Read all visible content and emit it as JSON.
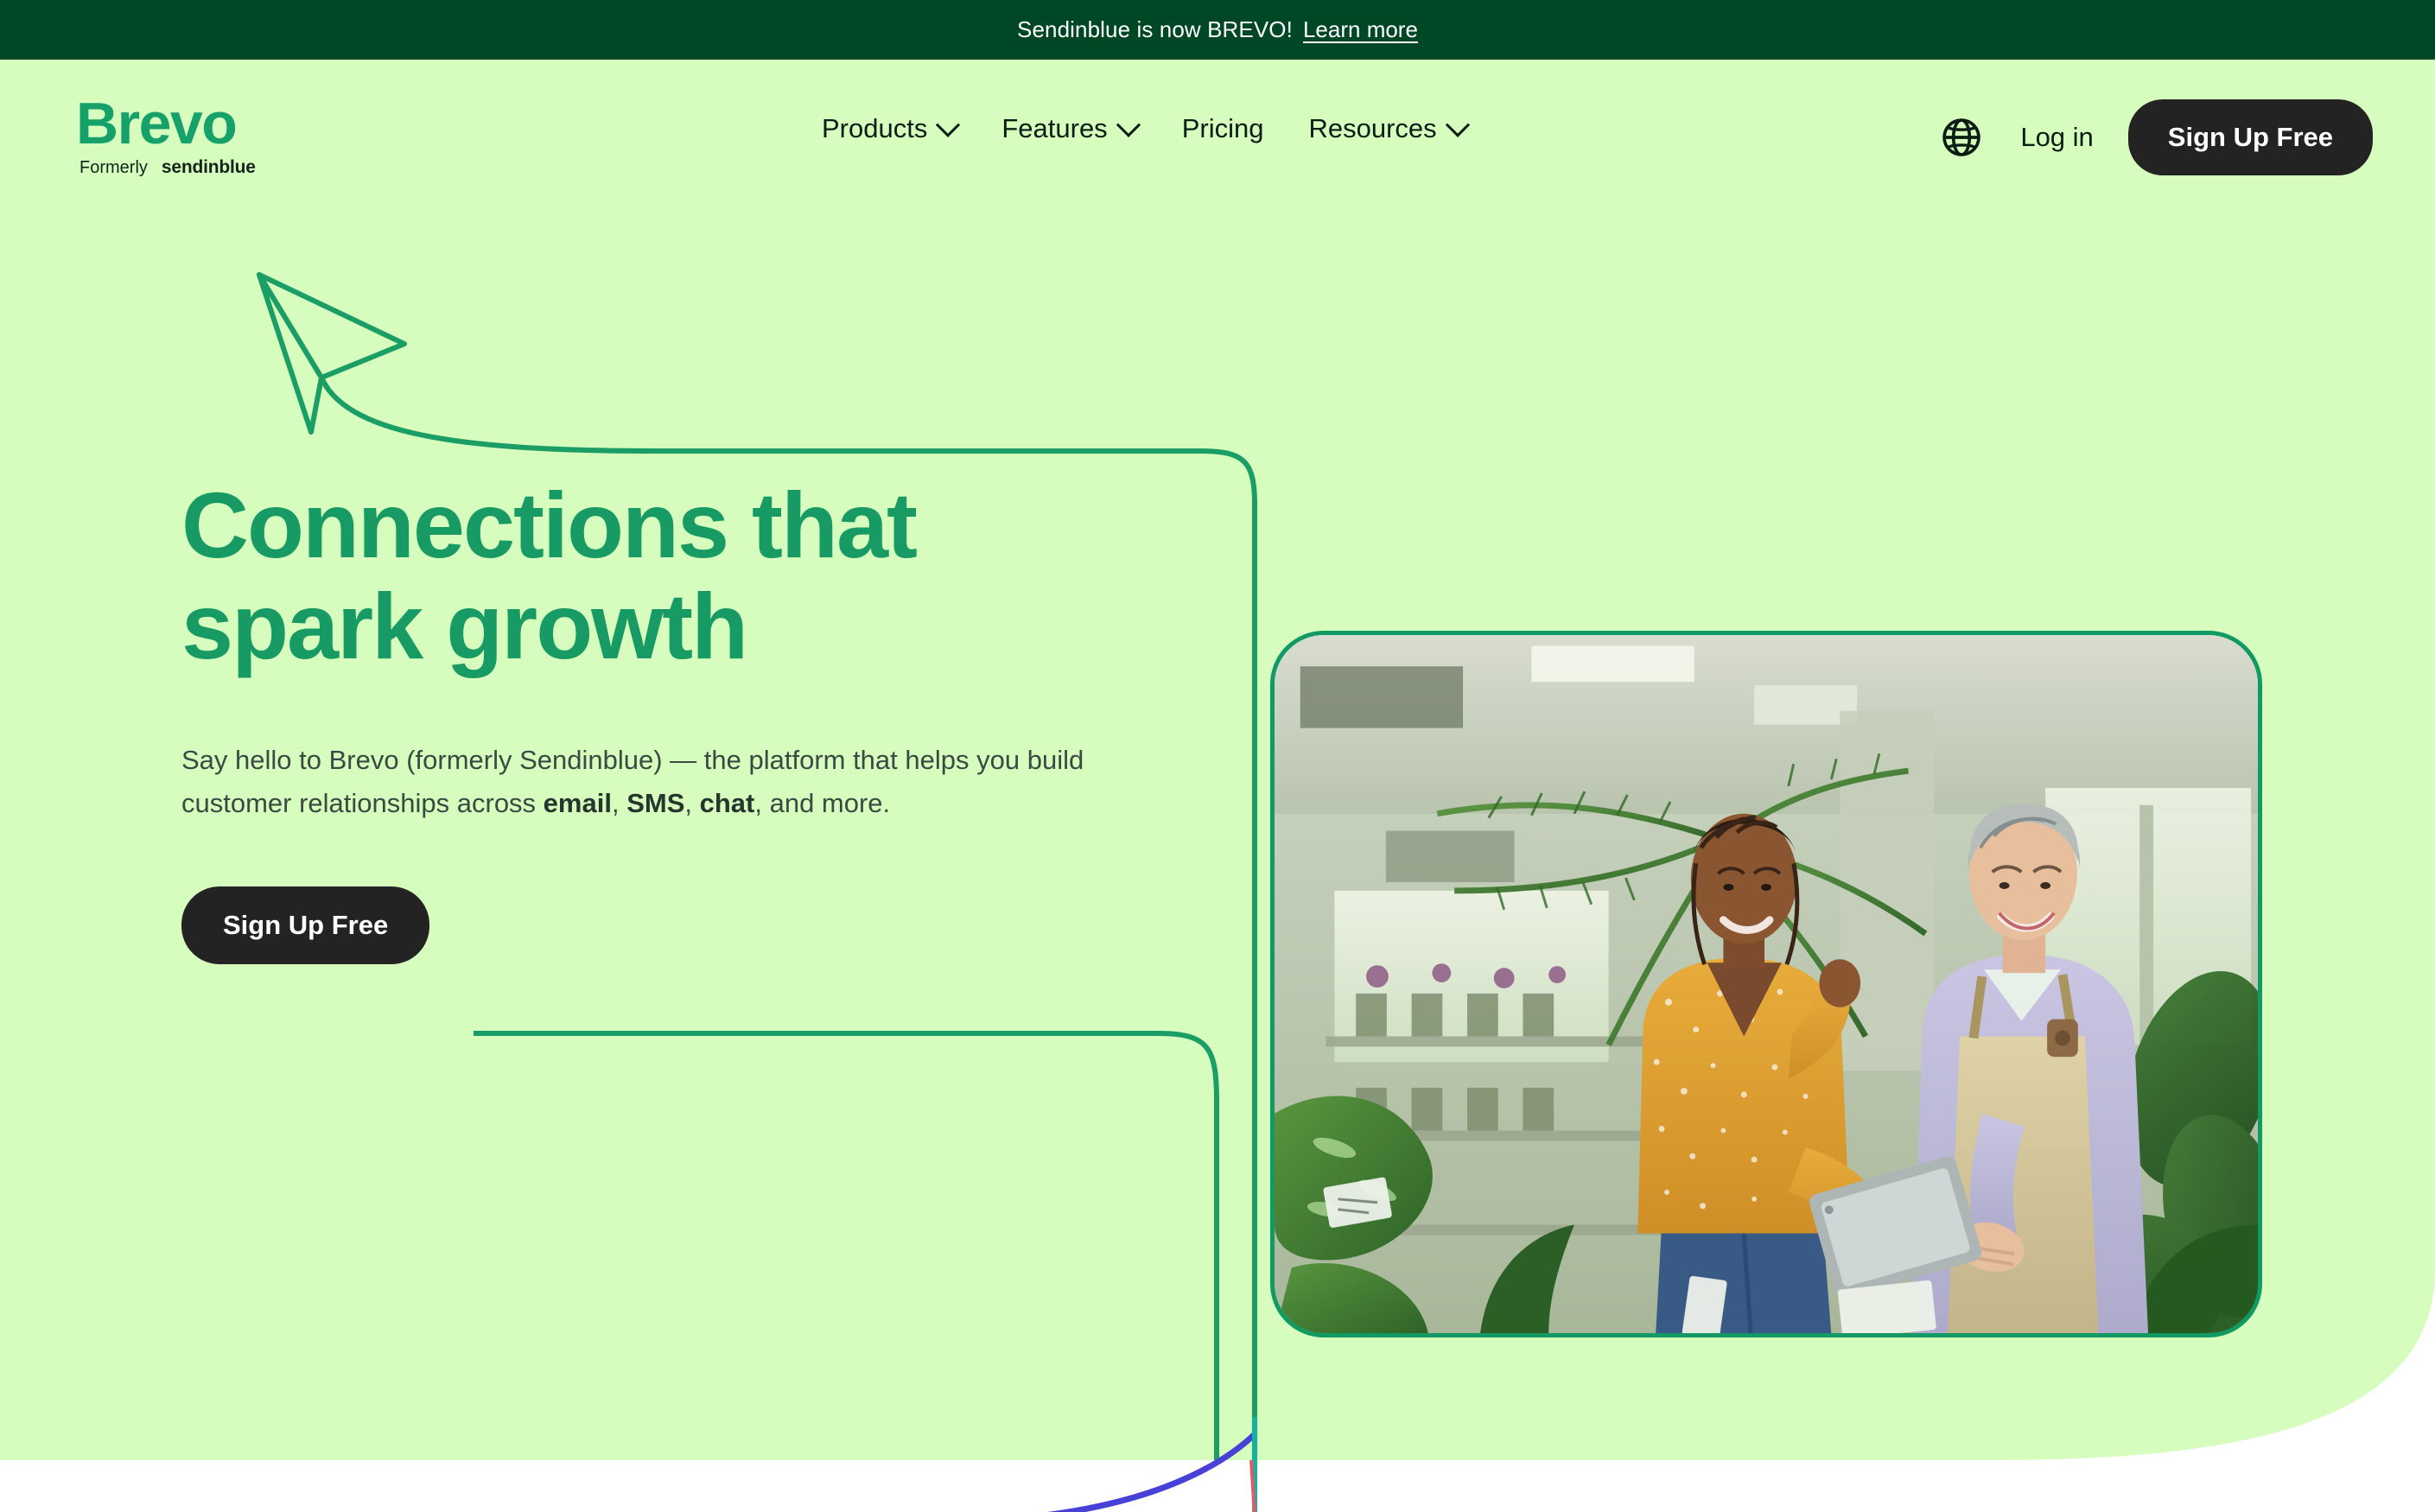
{
  "announcement": {
    "text": "Sendinblue is now BREVO!",
    "link_label": "Learn more",
    "bg_color": "#004726"
  },
  "brand": {
    "logo_word": "Brevo",
    "logo_formerly": "Formerly",
    "logo_former_name": "sendinblue",
    "logo_color": "#16a06a"
  },
  "nav": {
    "items": [
      {
        "label": "Products",
        "has_dropdown": true
      },
      {
        "label": "Features",
        "has_dropdown": true
      },
      {
        "label": "Pricing",
        "has_dropdown": false
      },
      {
        "label": "Resources",
        "has_dropdown": true
      }
    ],
    "language_icon": "globe-icon",
    "login_label": "Log in",
    "signup_label": "Sign Up Free"
  },
  "hero": {
    "title_line1": "Connections that",
    "title_line2": "spark growth",
    "title_color": "#179a63",
    "subtitle_parts": [
      {
        "text": "Say hello to Brevo (formerly Sendinblue) — the platform that helps you build customer relationships across ",
        "bold": false
      },
      {
        "text": "email",
        "bold": true
      },
      {
        "text": ", ",
        "bold": false
      },
      {
        "text": "SMS",
        "bold": true
      },
      {
        "text": ", ",
        "bold": false
      },
      {
        "text": "chat",
        "bold": true
      },
      {
        "text": ", and more.",
        "bold": false
      }
    ],
    "cta_label": "Sign Up Free",
    "background_color": "#d6fdbe",
    "decor_icon": "paper-plane-icon",
    "image_alt": "Two women in a plant shop looking at a tablet together"
  }
}
